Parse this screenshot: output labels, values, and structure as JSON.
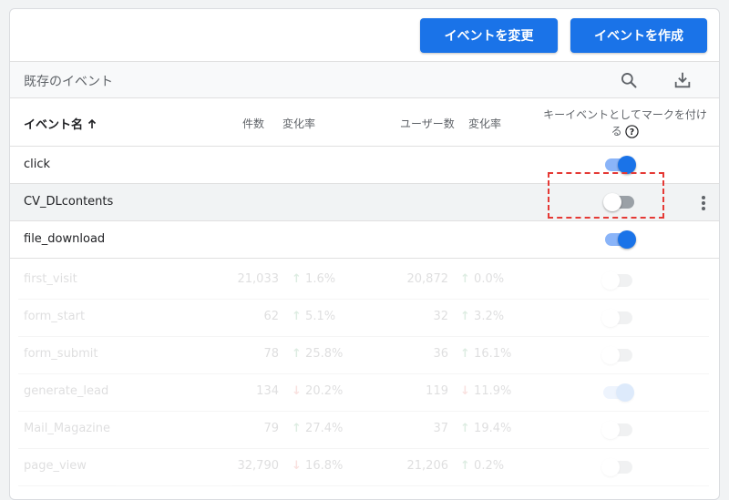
{
  "toolbar": {
    "change_label": "イベントを変更",
    "create_label": "イベントを作成"
  },
  "section": {
    "title": "既存のイベント",
    "icons": [
      "search-icon",
      "download-icon"
    ]
  },
  "table": {
    "columns": {
      "name": "イベント名",
      "count": "件数",
      "change_rate_1": "変化率",
      "users": "ユーザー数",
      "change_rate_2": "変化率",
      "key_event_line1": "キーイベントとしてマークを付け",
      "key_event_line2": "る"
    },
    "rows": [
      {
        "name": "click",
        "key_event": true
      },
      {
        "name": "CV_DLcontents",
        "key_event": false
      },
      {
        "name": "file_download",
        "key_event": true
      }
    ],
    "faded_rows": [
      {
        "name": "first_visit",
        "count": "21,033",
        "cr1": "1.6%",
        "cr1_dir": "up",
        "users": "20,872",
        "cr2": "0.0%",
        "cr2_dir": "up",
        "key_event": false
      },
      {
        "name": "form_start",
        "count": "62",
        "cr1": "5.1%",
        "cr1_dir": "up",
        "users": "32",
        "cr2": "3.2%",
        "cr2_dir": "up",
        "key_event": false
      },
      {
        "name": "form_submit",
        "count": "78",
        "cr1": "25.8%",
        "cr1_dir": "up",
        "users": "36",
        "cr2": "16.1%",
        "cr2_dir": "up",
        "key_event": false
      },
      {
        "name": "generate_lead",
        "count": "134",
        "cr1": "20.2%",
        "cr1_dir": "down",
        "users": "119",
        "cr2": "11.9%",
        "cr2_dir": "down",
        "key_event": true
      },
      {
        "name": "Mail_Magazine",
        "count": "79",
        "cr1": "27.4%",
        "cr1_dir": "up",
        "users": "37",
        "cr2": "19.4%",
        "cr2_dir": "up",
        "key_event": false
      },
      {
        "name": "page_view",
        "count": "32,790",
        "cr1": "16.8%",
        "cr1_dir": "down",
        "users": "21,206",
        "cr2": "0.2%",
        "cr2_dir": "up",
        "key_event": false
      }
    ]
  },
  "colors": {
    "primary": "#1a73e8",
    "highlight_box": "#e53935",
    "up": "#188038",
    "down": "#d93025"
  }
}
